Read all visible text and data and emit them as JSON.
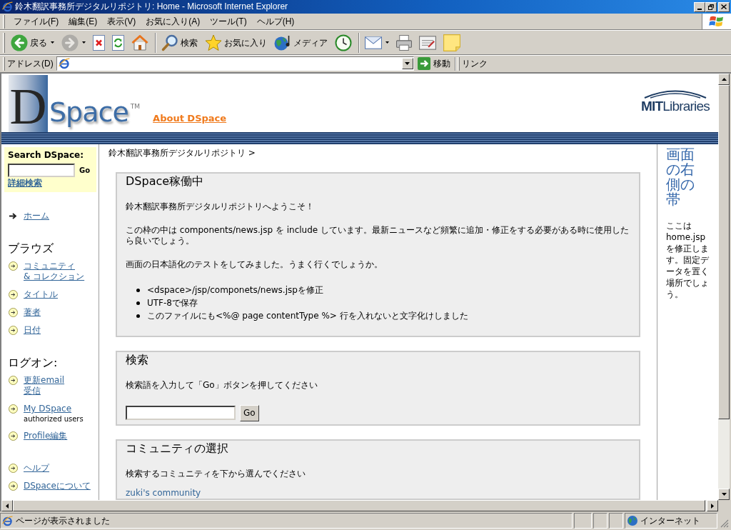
{
  "window": {
    "title": "鈴木翻訳事務所デジタルリポジトリ: Home - Microsoft Internet Explorer"
  },
  "menu_bar": [
    "ファイル(F)",
    "編集(E)",
    "表示(V)",
    "お気に入り(A)",
    "ツール(T)",
    "ヘルプ(H)"
  ],
  "toolbar": {
    "groups": [
      [
        {
          "kind": "back",
          "label": "戻る",
          "dropdown": true,
          "disabled": false
        },
        {
          "kind": "forward",
          "dropdown": true,
          "disabled": true
        },
        {
          "kind": "stop",
          "dropdown": false,
          "disabled": false
        },
        {
          "kind": "refresh",
          "dropdown": false,
          "disabled": false
        },
        {
          "kind": "home",
          "dropdown": false,
          "disabled": false
        }
      ],
      [
        {
          "kind": "search",
          "label": "検索",
          "dropdown": false,
          "disabled": false
        },
        {
          "kind": "favorites",
          "label": "お気に入り",
          "dropdown": false,
          "disabled": false
        },
        {
          "kind": "media",
          "label": "メディア",
          "dropdown": false,
          "disabled": false
        },
        {
          "kind": "history",
          "dropdown": false,
          "disabled": false
        }
      ],
      [
        {
          "kind": "mail",
          "dropdown": true,
          "disabled": false
        },
        {
          "kind": "print",
          "dropdown": false,
          "disabled": false
        },
        {
          "kind": "edit",
          "dropdown": false,
          "disabled": false
        },
        {
          "kind": "note",
          "dropdown": false,
          "disabled": false
        }
      ]
    ]
  },
  "address_bar": {
    "label": "アドレス(D)",
    "go_button": "移動",
    "links_label": "リンク"
  },
  "page": {
    "header": {
      "logo": {
        "initial": "D",
        "word": "Space",
        "mark": "TM"
      },
      "about_link": "About DSpace",
      "partner_logo": {
        "strong": "MIT",
        "light": "Libraries"
      }
    },
    "sidebar": {
      "search": {
        "heading": "Search DSpace:",
        "button": "Go",
        "advanced_link": "詳細検索"
      },
      "home_link": "ホーム",
      "sections": [
        {
          "heading": "ブラウズ",
          "links": [
            {
              "lines": [
                "コミュニティ",
                "& コレクション"
              ]
            },
            {
              "lines": [
                "タイトル"
              ]
            },
            {
              "lines": [
                "著者"
              ]
            },
            {
              "lines": [
                "日付"
              ]
            }
          ]
        },
        {
          "heading": "ログオン:",
          "links": [
            {
              "lines": [
                "更新email",
                "受信"
              ]
            },
            {
              "lines": [
                "My DSpace"
              ],
              "note": "authorized users"
            },
            {
              "lines": [
                "Profile編集"
              ]
            }
          ]
        },
        {
          "links": [
            {
              "lines": [
                "ヘルプ"
              ]
            },
            {
              "lines": [
                "DSpaceについて"
              ]
            }
          ]
        }
      ]
    },
    "breadcrumb": "鈴木翻訳事務所デジタルリポジトリ >",
    "boxes": [
      {
        "title": "DSpace稼働中",
        "paragraphs": [
          "鈴木翻訳事務所デジタルリポジトリへようこそ！",
          "この枠の中は components/news.jsp を include しています。最新ニュースなど頻繁に追加・修正をする必要がある時に使用したら良いでしょう。",
          "画面の日本語化のテストをしてみました。うまく行くでしょうか。"
        ],
        "bullets": [
          "<dspace>/jsp/componets/news.jspを修正",
          "UTF-8で保存",
          "このファイルにも<%@ page contentType %> 行を入れないと文字化けしました"
        ]
      },
      {
        "title": "検索",
        "paragraphs": [
          "検索語を入力して「Go」ボタンを押してください"
        ],
        "form": {
          "button": "Go"
        }
      },
      {
        "title": "コミュニティの選択",
        "paragraphs": [
          "検索するコミュニティを下から選んでください"
        ],
        "links": [
          "zuki's community"
        ]
      }
    ],
    "right_column": {
      "heading": "画面の右側の帯",
      "text": "ここはhome.jspを修正します。固定データを置く場所でしょう。"
    }
  },
  "status_bar": {
    "text": "ページが表示されました",
    "zone": "インターネット"
  }
}
